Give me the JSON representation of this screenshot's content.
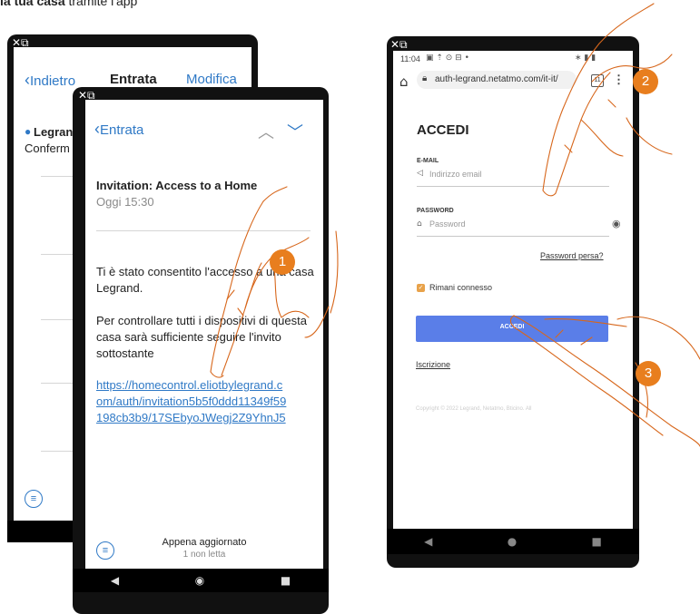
{
  "header_fragment": {
    "bold": "la tua casa",
    "rest": " tramite l'app"
  },
  "back_phone": {
    "status_icons": "✕⧉",
    "back_label": "Indietro",
    "title": "Entrata",
    "edit_label": "Modifica",
    "item_sender": "Legrand",
    "item_preview": "Conferm"
  },
  "front_phone": {
    "status_icons": "✕⧉",
    "back_label": "Entrata",
    "subject": "Invitation: Access to a Home",
    "date": "Oggi 15:30",
    "body_p1": "Ti è stato consentito l'accesso a una casa Legrand.",
    "body_p2": "Per controllare tutti i dispositivi di questa casa sarà sufficiente seguire l'invito sottostante",
    "link": "https://homecontrol.eliotbylegrand.com/auth/invitation5b5f0ddd11349f59198cb3b9/17SEbyoJWegj2Z9YhnJ5",
    "footer_title": "Appena aggiornato",
    "footer_sub": "1 non letta"
  },
  "right_phone": {
    "status_icons": "✕⧉",
    "time": "11:04",
    "url": "auth-legrand.netatmo.com/it-it/",
    "tab_count": "11",
    "heading": "ACCEDI",
    "email_label": "E-MAIL",
    "email_placeholder": "Indirizzo email",
    "password_label": "PASSWORD",
    "password_placeholder": "Password",
    "forgot_label": "Password persa?",
    "remember_label": "Rimani connesso",
    "submit_label": "ACCEDI",
    "signup_label": "Iscrizione",
    "copyright": "Copyright © 2022 Legrand, Netatmo, Bticino. All"
  },
  "steps": [
    "1",
    "2",
    "3"
  ],
  "colors": {
    "accent_blue": "#2f79c6",
    "button_blue": "#5a7ee8",
    "step_orange": "#e87e1e",
    "checkbox_orange": "#e8a24a"
  }
}
